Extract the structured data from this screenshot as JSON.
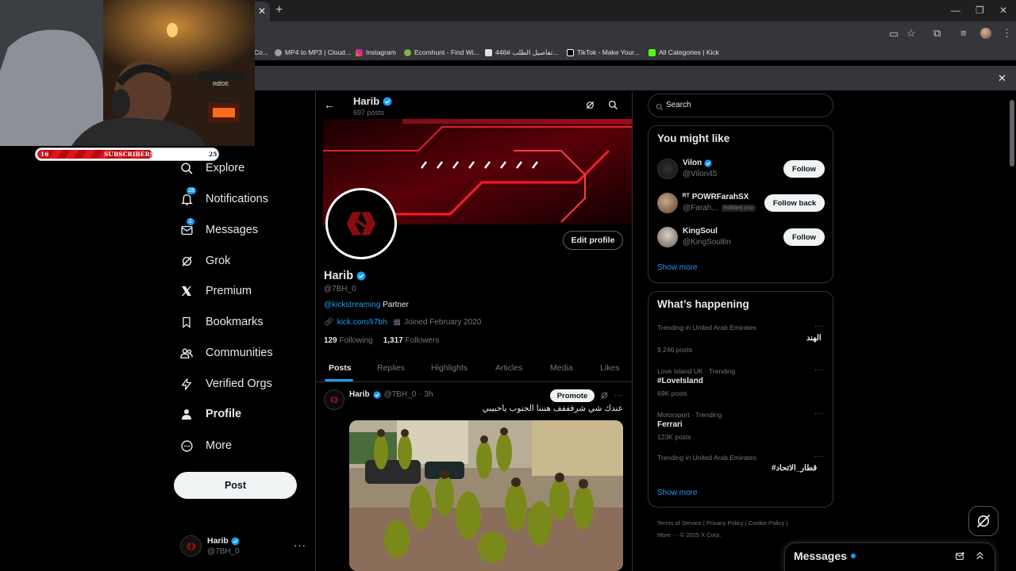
{
  "browser": {
    "bookmarks": [
      {
        "label": "Co...",
        "color": "#888888"
      },
      {
        "label": "MP4 to MP3 | Cloud...",
        "color": "#9aa0a6"
      },
      {
        "label": "Instagram",
        "color": "#e1306c"
      },
      {
        "label": "Ecomhunt - Find Wi...",
        "color": "#7cb342"
      },
      {
        "label": "تفاصيل الطلب #446...",
        "color": "#e0e0e0"
      },
      {
        "label": "TikTok - Make Your...",
        "color": "#ffffff"
      },
      {
        "label": "All Categories | Kick",
        "color": "#53fc18"
      }
    ]
  },
  "webcam": {
    "sub_current": "16",
    "sub_label": "SUBSCRIBERS",
    "sub_goal": "25",
    "sub_progress": 0.64
  },
  "nav": {
    "items": [
      {
        "label": "Explore",
        "icon": "search-icon"
      },
      {
        "label": "Notifications",
        "icon": "bell-icon",
        "badge": "18"
      },
      {
        "label": "Messages",
        "icon": "envelope-icon",
        "badge": "1"
      },
      {
        "label": "Grok",
        "icon": "grok-icon"
      },
      {
        "label": "Premium",
        "icon": "x-logo-icon"
      },
      {
        "label": "Bookmarks",
        "icon": "bookmark-icon"
      },
      {
        "label": "Communities",
        "icon": "people-icon"
      },
      {
        "label": "Verified Orgs",
        "icon": "lightning-icon"
      },
      {
        "label": "Profile",
        "icon": "person-icon"
      },
      {
        "label": "More",
        "icon": "more-circle-icon"
      }
    ],
    "post_label": "Post",
    "account_name": "Harib",
    "account_handle": "@7BH_0"
  },
  "profile": {
    "header_name": "Harib",
    "header_posts": "697 posts",
    "name": "Harib",
    "handle": "@7BH_0",
    "bio_link": "@kickstreaming",
    "bio_text": "Partner",
    "website": "kick.com/li7bh",
    "joined": "Joined February 2020",
    "following_count": "129",
    "following_label": "Following",
    "followers_count": "1,317",
    "followers_label": "Followers",
    "edit_label": "Edit profile",
    "tabs": [
      "Posts",
      "Replies",
      "Highlights",
      "Articles",
      "Media",
      "Likes"
    ]
  },
  "tweet": {
    "name": "Harib",
    "handle": "@7BH_0",
    "time": "· 3h",
    "promote_label": "Promote",
    "text": "عندك شي شرفففف هنننا الجنوب ياحبيبي"
  },
  "sidebar": {
    "search_placeholder": "Search",
    "you_might_like": "You might like",
    "suggestions": [
      {
        "name": "Vilon",
        "handle": "@Vilon45",
        "button": "Follow",
        "verified": true,
        "follows_you": ""
      },
      {
        "name": "ᴿᵀ POWRFarahSX",
        "handle": "@Farah...",
        "button": "Follow back",
        "verified": false,
        "follows_you": "Follows you"
      },
      {
        "name": "KingSoul",
        "handle": "@KingSoultin",
        "button": "Follow",
        "verified": false,
        "follows_you": ""
      }
    ],
    "show_more": "Show more",
    "whats_happening": "What’s happening",
    "trends": [
      {
        "context": "Trending in United Arab Emirates",
        "topic": "الهند",
        "count": "9,246 posts"
      },
      {
        "context": "Love Island UK · Trending",
        "topic": "#LoveIsland",
        "count": "69K posts"
      },
      {
        "context": "Motorsport · Trending",
        "topic": "Ferrari",
        "count": "123K posts"
      },
      {
        "context": "Trending in United Arab Emirates",
        "topic": "#قطار_الاتحاد",
        "count": ""
      }
    ],
    "show_more_2": "Show more",
    "footer_line1": "Terms of Service  |   Privacy Policy  |   Cookie Policy  |",
    "footer_line2": "More ···   © 2025 X Corp.",
    "messages_title": "Messages"
  },
  "colors": {
    "accent": "#1d9bf0",
    "background": "#000000",
    "border": "#2f3336",
    "muted": "#71767b"
  }
}
